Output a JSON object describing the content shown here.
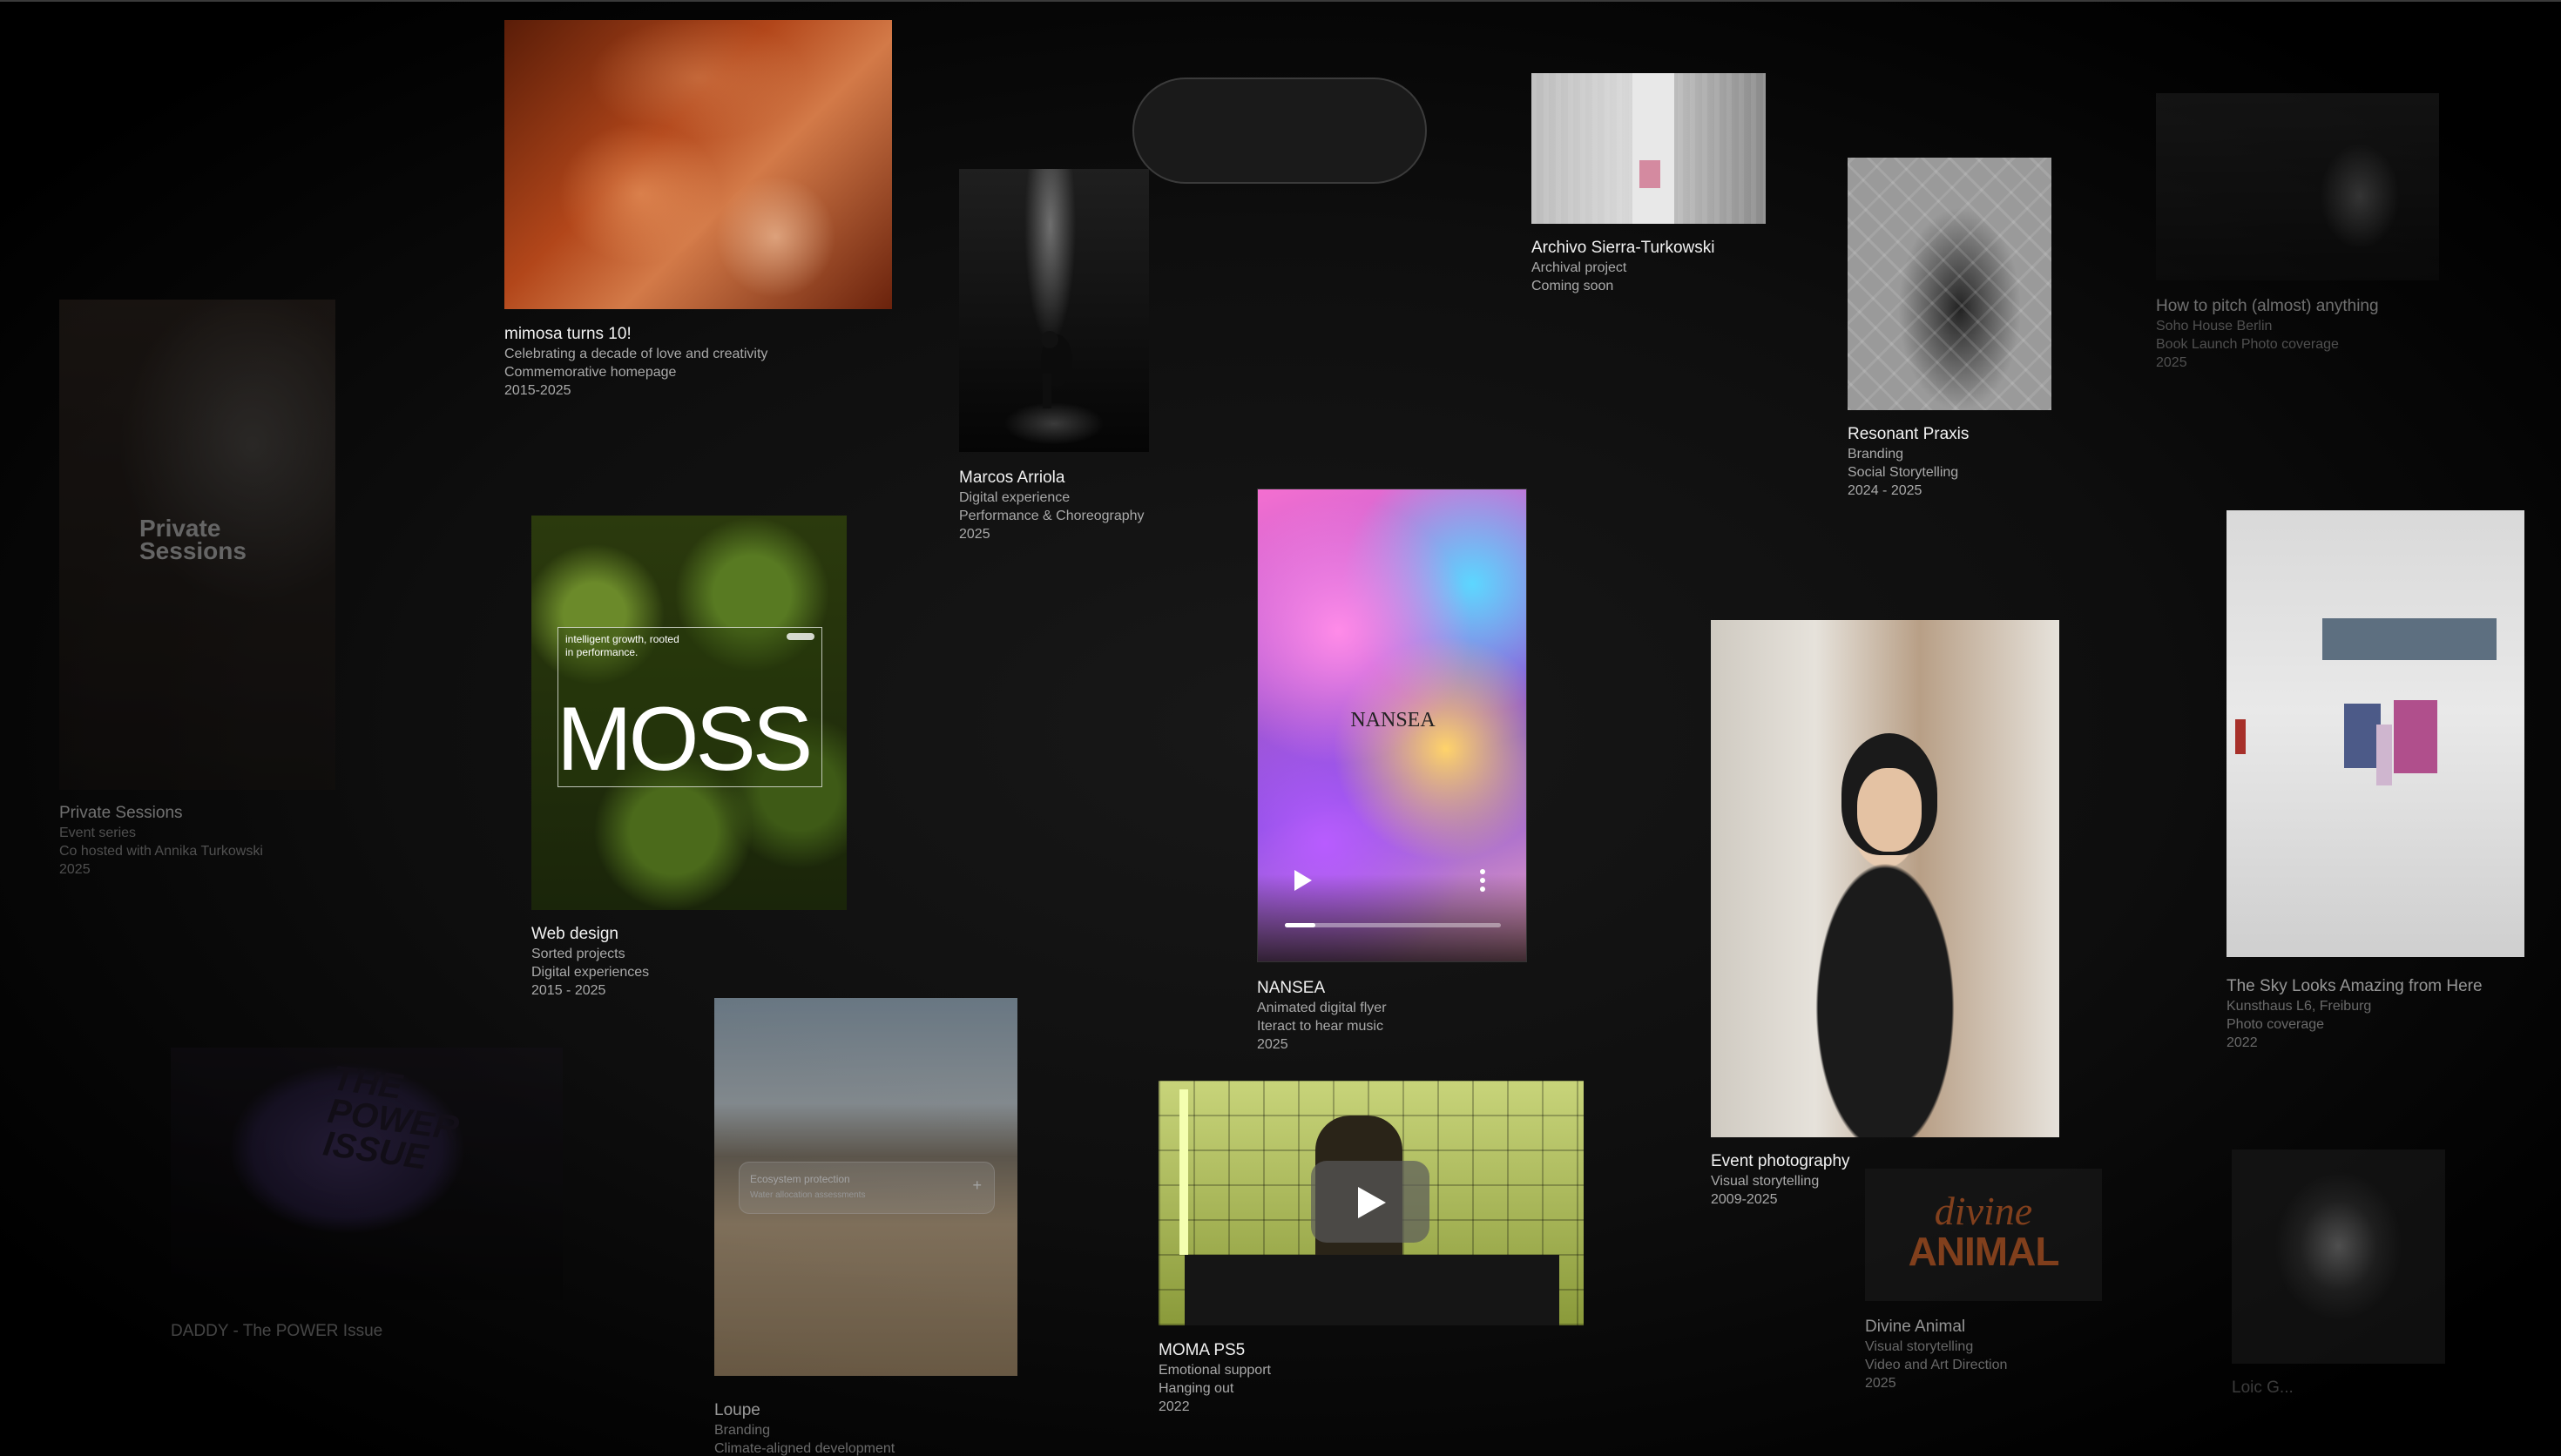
{
  "cards": {
    "mimosa": {
      "title": "mimosa turns 10!",
      "lines": [
        "Celebrating a decade of love and creativity",
        "Commemorative homepage",
        "2015-2025"
      ]
    },
    "marcos": {
      "title": "Marcos Arriola",
      "lines": [
        "Digital experience",
        "Performance & Choreography",
        "2025"
      ]
    },
    "archivo": {
      "title": "Archivo Sierra-Turkowski",
      "lines": [
        "Archival project",
        "Coming soon"
      ]
    },
    "resonant": {
      "title": "Resonant Praxis",
      "lines": [
        "Branding",
        "Social Storytelling",
        "2024 - 2025"
      ]
    },
    "pitch": {
      "title": "How to pitch (almost) anything",
      "lines": [
        "Soho House Berlin",
        "Book Launch Photo coverage",
        "2025"
      ]
    },
    "private": {
      "title": "Private Sessions",
      "lines": [
        "Event series",
        "Co hosted with Annika Turkowski",
        "2025"
      ],
      "overlay": "Private\nSessions"
    },
    "web": {
      "title": "Web design",
      "lines": [
        "Sorted projects",
        "Digital experiences",
        "2015 - 2025"
      ],
      "overlay_small": "intelligent growth, rooted\nin performance.",
      "overlay_big": "MOSS"
    },
    "nansea": {
      "title": "NANSEA",
      "lines": [
        "Animated digital flyer",
        "Iteract to hear music",
        "2025"
      ],
      "overlay": "NANSEA",
      "progress": 0.14
    },
    "event": {
      "title": "Event photography",
      "lines": [
        "Visual storytelling",
        "2009-2025"
      ]
    },
    "sky": {
      "title": "The Sky Looks Amazing from Here",
      "lines": [
        "Kunsthaus L6, Freiburg",
        "Photo coverage",
        "2022"
      ]
    },
    "daddy": {
      "title": "DADDY - The POWER Issue",
      "overlay": "THE\nPOWER\nISSUE"
    },
    "loupe": {
      "title": "Loupe",
      "lines": [
        "Branding",
        "Climate-aligned development"
      ],
      "panel_title": "Ecosystem protection",
      "panel_sub": "Water allocation assessments",
      "panel_plus": "+"
    },
    "moma": {
      "title": "MOMA PS5",
      "lines": [
        "Emotional support",
        "Hanging out",
        "2022"
      ]
    },
    "divine": {
      "title": "Divine Animal",
      "lines": [
        "Visual storytelling",
        "Video and Art Direction",
        "2025"
      ],
      "logo_top": "divine",
      "logo_bottom": "ANIMAL"
    },
    "loic": {
      "title": "Loic G..."
    }
  },
  "colors": {
    "background": "#000000",
    "title": "#f2f2f2",
    "subtitle": "#a9a9a9",
    "divine_orange": "#d2642a"
  }
}
